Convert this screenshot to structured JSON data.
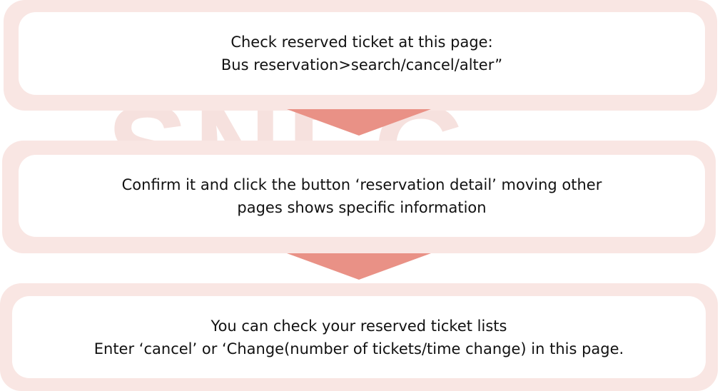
{
  "watermark": {
    "text": "SNEG"
  },
  "steps": [
    {
      "lines": [
        "Check reserved ticket at this page:",
        "Bus reservation>search/cancel/alter”"
      ]
    },
    {
      "lines": [
        "Confirm it and click the button ‘reservation detail’ moving other",
        "pages shows specific information"
      ]
    },
    {
      "lines": [
        "You can check your reserved ticket lists",
        "Enter ‘cancel’ or ‘Change(number of tickets/time change) in this page."
      ]
    }
  ],
  "colors": {
    "band": "#f9e6e3",
    "arrow": "#e99186",
    "card": "#ffffff",
    "text": "#111111"
  }
}
